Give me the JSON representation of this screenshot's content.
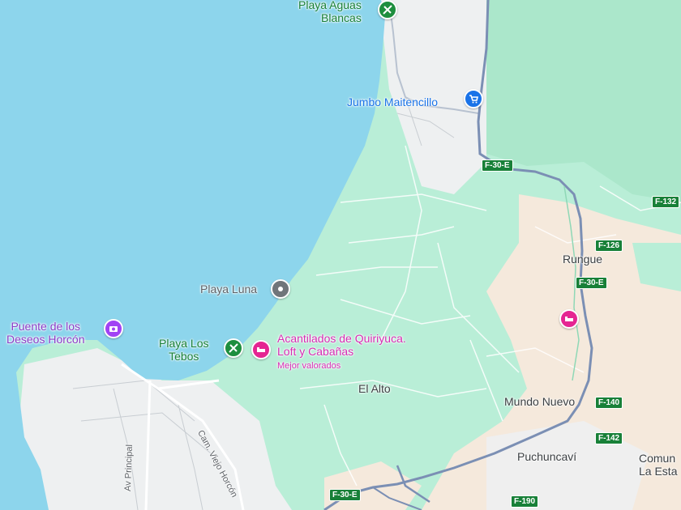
{
  "places": {
    "playa_aguas_blancas": "Playa Aguas\nBlancas",
    "jumbo": "Jumbo Maitencillo",
    "playa_luna": "Playa Luna",
    "puente": "Puente de los\nDeseos Horcón",
    "playa_los_tebos": "Playa Los\nTebos",
    "acantilados": "Acantilados de Quiriyuca.\nLoft y Cabañas",
    "acantilados_sub": "Mejor valorados",
    "el_alto": "El Alto",
    "rungue": "Rungue",
    "mundo_nuevo": "Mundo Nuevo",
    "puchuncavi": "Puchuncaví",
    "comuna": "Comun\nLa Esta"
  },
  "streets": {
    "av_principal": "Av Principal",
    "cam_viejo_horcon": "Cam. Viejo Horcón"
  },
  "road_shields": {
    "f30e_1": "F-30-E",
    "f132": "F-132",
    "f126": "F-126",
    "f30e_2": "F-30-E",
    "f140": "F-140",
    "f142": "F-142",
    "f190": "F-190",
    "f30e_3": "F-30-E"
  },
  "icons": {
    "beach": "beach-icon",
    "shopping": "shopping-cart-icon",
    "pin": "place-pin-icon",
    "camera": "camera-icon",
    "hotel": "hotel-icon"
  },
  "colors": {
    "water": "#8dd5ec",
    "land": "#b9eed7",
    "urban": "#eef0f1",
    "rural": "#f5e9dc",
    "road": "#7b8fb4"
  }
}
